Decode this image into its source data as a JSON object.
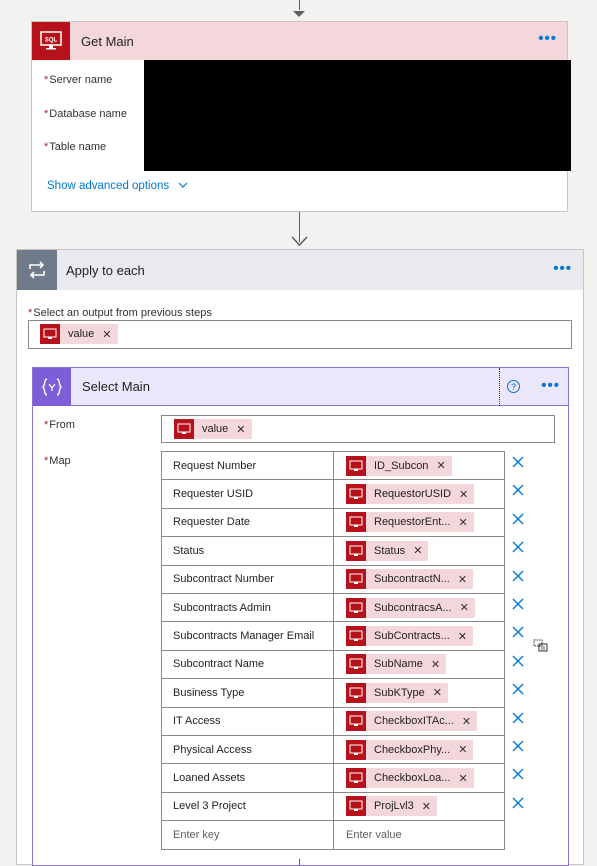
{
  "get_main": {
    "title": "Get Main",
    "more": "•••",
    "fields": [
      {
        "label": "Server name"
      },
      {
        "label": "Database name"
      },
      {
        "label": "Table name"
      }
    ],
    "advanced": "Show advanced options"
  },
  "apply_each": {
    "title": "Apply to each",
    "more": "•••",
    "output_label": "Select an output from previous steps",
    "output_token": "value"
  },
  "select_main": {
    "title": "Select Main",
    "more": "•••",
    "help": "?",
    "from_label": "From",
    "from_token": "value",
    "map_label": "Map",
    "rows": [
      {
        "key": "Request Number",
        "value": "ID_Subcon"
      },
      {
        "key": "Requester USID",
        "value": "RequestorUSID"
      },
      {
        "key": "Requester Date",
        "value": "RequestorEnt..."
      },
      {
        "key": "Status",
        "value": "Status"
      },
      {
        "key": "Subcontract Number",
        "value": "SubcontractN..."
      },
      {
        "key": "Subcontracts Admin",
        "value": "SubcontracsA..."
      },
      {
        "key": "Subcontracts Manager Email",
        "value": "SubContracts..."
      },
      {
        "key": "Subcontract Name",
        "value": "SubName"
      },
      {
        "key": "Business Type",
        "value": "SubKType"
      },
      {
        "key": "IT Access",
        "value": "CheckboxITAc..."
      },
      {
        "key": "Physical Access",
        "value": "CheckboxPhy..."
      },
      {
        "key": "Loaned Assets",
        "value": "CheckboxLoa..."
      },
      {
        "key": "Level 3 Project",
        "value": "ProjLvl3"
      }
    ],
    "key_placeholder": "Enter key",
    "value_placeholder": "Enter value"
  },
  "icons": {
    "sql": "sql-icon",
    "loop": "loop-icon",
    "select": "curly-braces-icon",
    "delete": "close-icon",
    "switch_mode": "switch-mode-icon"
  },
  "colors": {
    "sql_red": "#b5121b",
    "token_bg": "#f4d7da",
    "link_blue": "#0078d4",
    "select_purple": "#7e5ed6"
  }
}
